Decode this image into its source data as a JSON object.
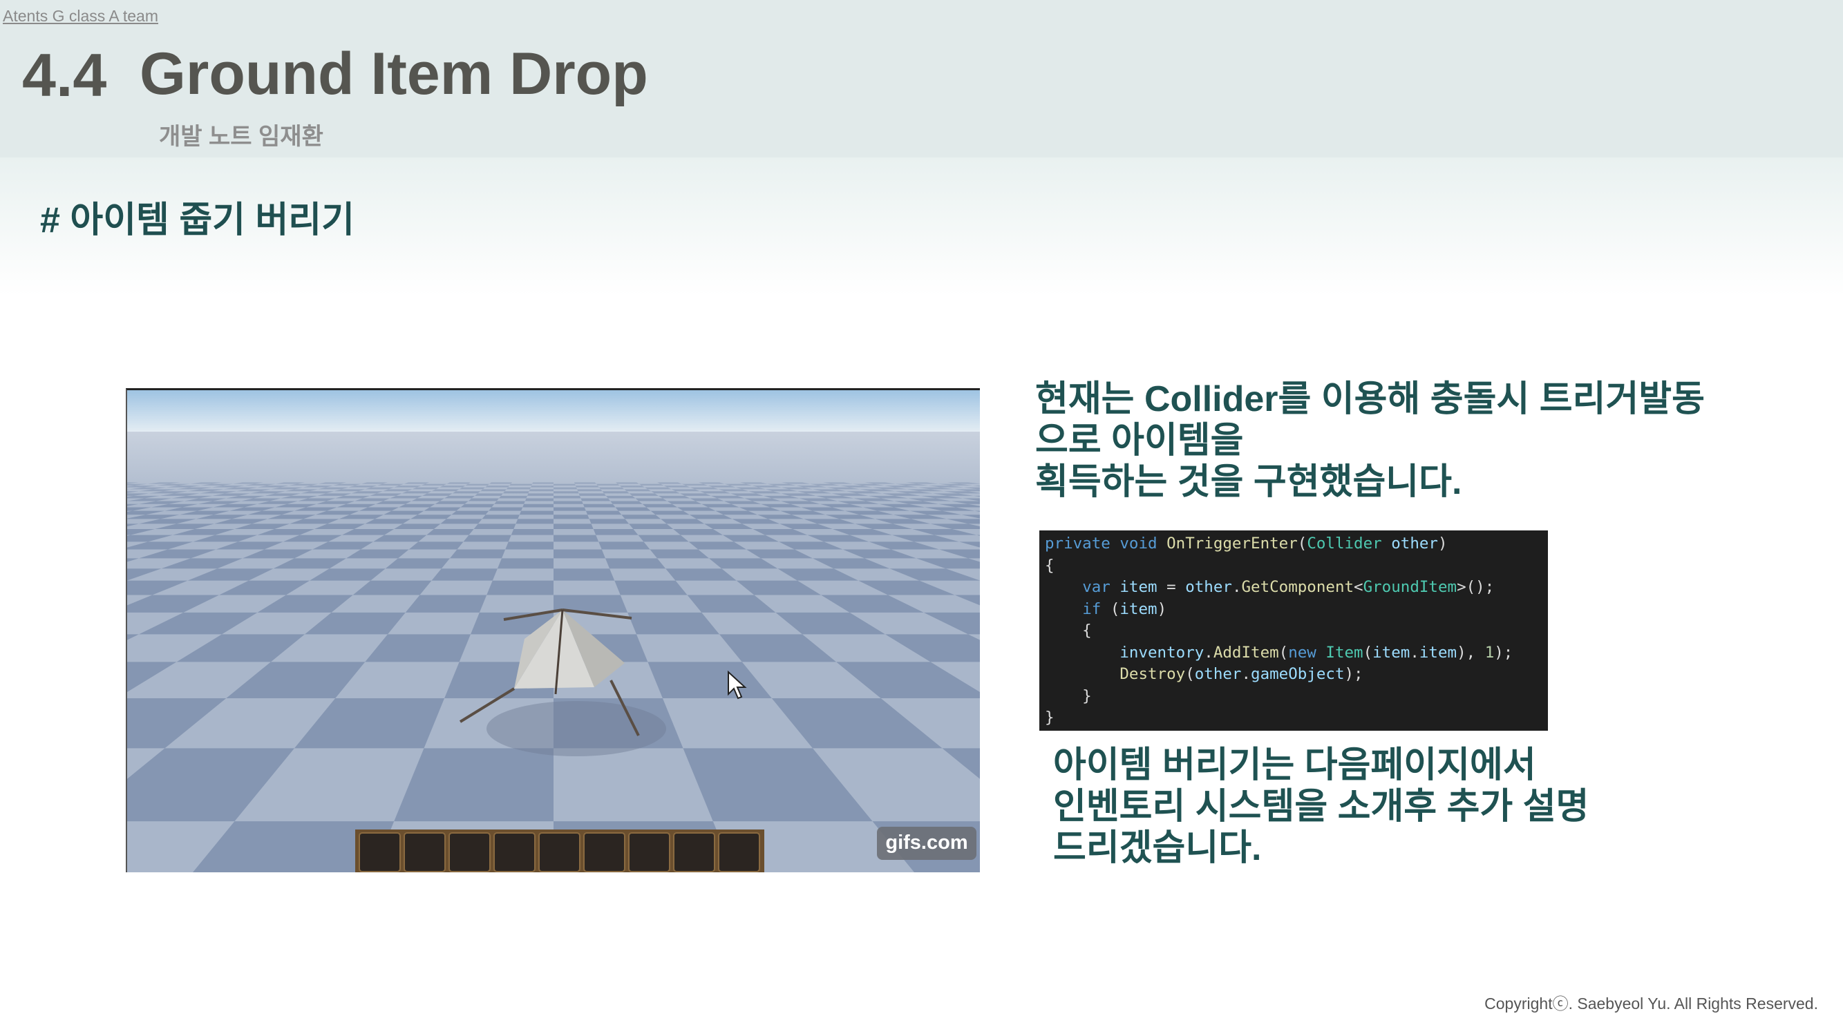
{
  "header": {
    "team_link": "Atents G class A team",
    "section_number": "4.4",
    "section_title": "Ground Item Drop",
    "subtitle": "개발 노트 임재환"
  },
  "main": {
    "heading": "# 아이템 줍기 버리기",
    "description": "현재는 Collider를 이용해 충돌시 트리거발동\n으로 아이템을\n획득하는 것을 구현했습니다.",
    "note": "아이템 버리기는 다음페이지에서\n인벤토리 시스템을 소개후 추가 설명\n드리겠습니다."
  },
  "game_image": {
    "watermark": "gifs.com",
    "hotbar_slots": 9
  },
  "code_lines": [
    "private void OnTriggerEnter(Collider other)",
    "{",
    "    var item = other.GetComponent<GroundItem>();",
    "    if (item)",
    "    {",
    "        inventory.AddItem(new Item(item.item), 1);",
    "        Destroy(other.gameObject);",
    "    }",
    "}"
  ],
  "footer": {
    "copyright": "Copyrightⓒ. Saebyeol Yu. All Rights Reserved."
  }
}
